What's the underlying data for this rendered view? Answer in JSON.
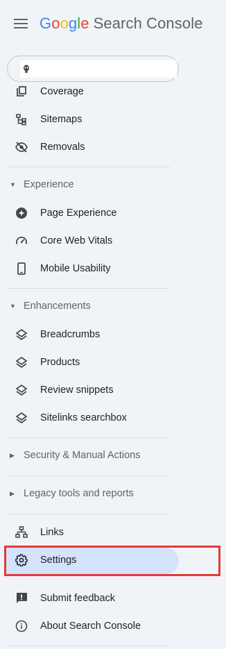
{
  "header": {
    "brand_letters": [
      "G",
      "o",
      "o",
      "g",
      "l",
      "e"
    ],
    "product": "Search Console"
  },
  "nav": {
    "index_items": [
      {
        "label": "Coverage",
        "icon": "coverage-icon"
      },
      {
        "label": "Sitemaps",
        "icon": "sitemaps-icon"
      },
      {
        "label": "Removals",
        "icon": "removals-icon"
      }
    ],
    "experience": {
      "header": "Experience",
      "items": [
        {
          "label": "Page Experience",
          "icon": "page-experience-icon"
        },
        {
          "label": "Core Web Vitals",
          "icon": "speedometer-icon"
        },
        {
          "label": "Mobile Usability",
          "icon": "smartphone-icon"
        }
      ]
    },
    "enhancements": {
      "header": "Enhancements",
      "items": [
        {
          "label": "Breadcrumbs",
          "icon": "layers-icon"
        },
        {
          "label": "Products",
          "icon": "layers-icon"
        },
        {
          "label": "Review snippets",
          "icon": "layers-icon"
        },
        {
          "label": "Sitelinks searchbox",
          "icon": "layers-icon"
        }
      ]
    },
    "security": {
      "header": "Security & Manual Actions"
    },
    "legacy": {
      "header": "Legacy tools and reports"
    },
    "links": {
      "label": "Links",
      "icon": "links-icon"
    },
    "settings": {
      "label": "Settings",
      "icon": "gear-icon",
      "active": true
    },
    "feedback": {
      "label": "Submit feedback",
      "icon": "feedback-icon"
    },
    "about": {
      "label": "About Search Console",
      "icon": "info-icon"
    }
  },
  "colors": {
    "active_bg": "#d3e3fd",
    "highlight": "#e53935"
  }
}
